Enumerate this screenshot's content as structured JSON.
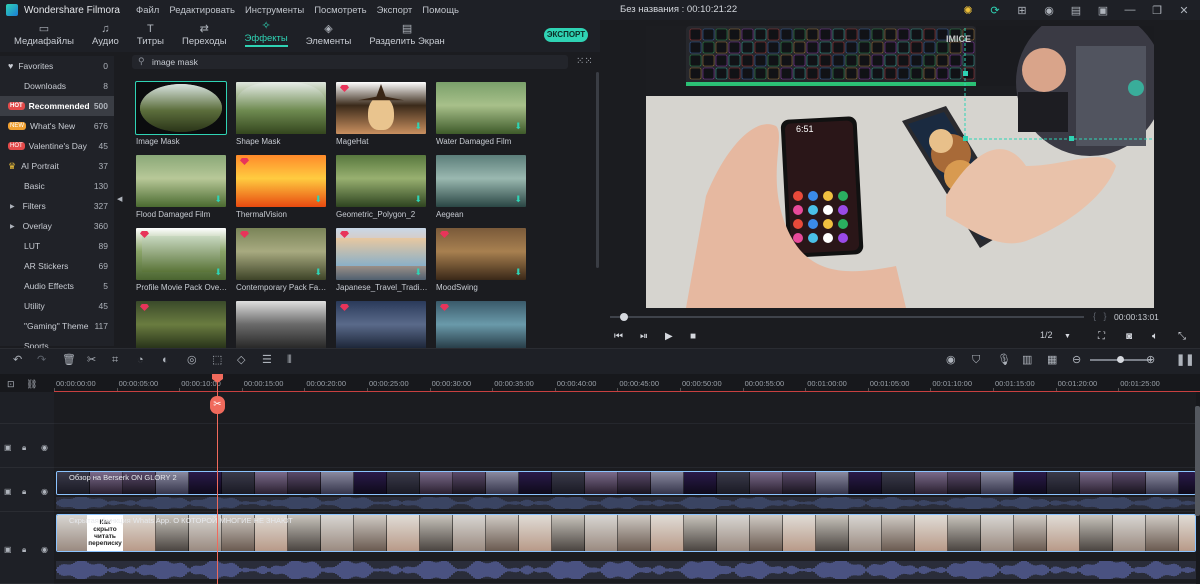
{
  "app": {
    "name": "Wondershare Filmora",
    "menu": [
      "Файл",
      "Редактировать",
      "Инструменты",
      "Посмотреть",
      "Экспорт",
      "Помощь"
    ],
    "document": "Без названия : 00:10:21:22"
  },
  "tabs": [
    {
      "label": "Медиафайлы",
      "icon": "folder-icon"
    },
    {
      "label": "Аудио",
      "icon": "music-icon"
    },
    {
      "label": "Титры",
      "icon": "text-icon"
    },
    {
      "label": "Переходы",
      "icon": "transition-icon"
    },
    {
      "label": "Эффекты",
      "icon": "effects-icon",
      "active": true
    },
    {
      "label": "Элементы",
      "icon": "elements-icon"
    },
    {
      "label": "Разделить Экран",
      "icon": "split-screen-icon"
    }
  ],
  "export_label": "ЭКСПОРТ",
  "categories": [
    {
      "label": "Favorites",
      "count": "0",
      "kind": "star"
    },
    {
      "label": "Downloads",
      "count": "8",
      "kind": "plain"
    },
    {
      "label": "Recommended",
      "count": "500",
      "kind": "hot",
      "selected": true
    },
    {
      "label": "What's New",
      "count": "676",
      "kind": "new"
    },
    {
      "label": "Valentine's Day",
      "count": "45",
      "kind": "hot"
    },
    {
      "label": "AI Portrait",
      "count": "37",
      "kind": "crown"
    },
    {
      "label": "Basic",
      "count": "130",
      "kind": "plain"
    },
    {
      "label": "Filters",
      "count": "327",
      "kind": "tri"
    },
    {
      "label": "Overlay",
      "count": "360",
      "kind": "tri"
    },
    {
      "label": "LUT",
      "count": "89",
      "kind": "plain"
    },
    {
      "label": "AR Stickers",
      "count": "69",
      "kind": "plain"
    },
    {
      "label": "Audio Effects",
      "count": "5",
      "kind": "plain"
    },
    {
      "label": "Utility",
      "count": "45",
      "kind": "plain"
    },
    {
      "label": "\"Gaming\" Theme",
      "count": "117",
      "kind": "plain"
    },
    {
      "label": "Sports",
      "count": "",
      "kind": "plain"
    }
  ],
  "badges": {
    "hot": "HOT",
    "new": "NEW"
  },
  "search": {
    "value": "image mask"
  },
  "effects": [
    {
      "name": "Image Mask",
      "premium": false,
      "download": false,
      "selected": true
    },
    {
      "name": "Shape Mask",
      "premium": false,
      "download": false
    },
    {
      "name": "MageHat",
      "premium": true,
      "download": true
    },
    {
      "name": "Water Damaged Film",
      "premium": false,
      "download": true
    },
    {
      "name": "Flood Damaged Film",
      "premium": false,
      "download": true
    },
    {
      "name": "ThermalVision",
      "premium": true,
      "download": true
    },
    {
      "name": "Geometric_Polygon_2",
      "premium": false,
      "download": true
    },
    {
      "name": "Aegean",
      "premium": false,
      "download": true
    },
    {
      "name": "Profile Movie Pack Overl...",
      "premium": true,
      "download": true
    },
    {
      "name": "Contemporary Pack Fas...",
      "premium": true,
      "download": true
    },
    {
      "name": "Japanese_Travel_Traditi...",
      "premium": true,
      "download": true
    },
    {
      "name": "MoodSwing",
      "premium": true,
      "download": true
    },
    {
      "name": "",
      "premium": true,
      "download": false
    },
    {
      "name": "",
      "premium": false,
      "download": false
    },
    {
      "name": "",
      "premium": true,
      "download": false
    },
    {
      "name": "",
      "premium": true,
      "download": false
    }
  ],
  "preview": {
    "timecode": "00:00:13:01",
    "ratio": "1/2",
    "phone_time": "6:51",
    "keyboard_brand": "IMICE"
  },
  "timeline": {
    "ruler": [
      "00:00:00:00",
      "00:00:05:00",
      "00:00:10:00",
      "00:00:15:00",
      "00:00:20:00",
      "00:00:25:00",
      "00:00:30:00",
      "00:00:35:00",
      "00:00:40:00",
      "00:00:45:00",
      "00:00:50:00",
      "00:00:55:00",
      "00:01:00:00",
      "00:01:05:00",
      "00:01:10:00",
      "00:01:15:00",
      "00:01:20:00",
      "00:01:25:00"
    ],
    "clip1_title": "Обзор на Berserk ON GLORY 2",
    "clip2_title": "Скрытая функция Whats App. О КОТОРОЙ МНОГИЕ НЕ ЗНАЮТ",
    "clip2_overlay": "Как скрыто читать переписку"
  }
}
